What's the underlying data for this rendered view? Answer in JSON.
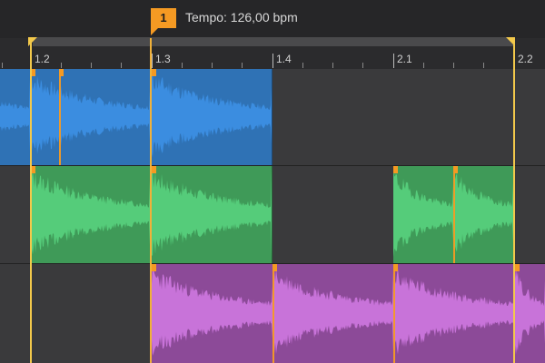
{
  "marker": {
    "number": "1",
    "label": "Tempo: 126,00 bpm"
  },
  "ruler": {
    "bars": [
      "1.2",
      "1.3",
      "1.4",
      "2.1",
      "2.2"
    ]
  },
  "tracks": [
    {
      "color_region": "#2f72b5",
      "color_wave": "#3b8de0"
    },
    {
      "color_region": "#3f9a58",
      "color_wave": "#55cc7a"
    },
    {
      "color_region": "#8c4a98",
      "color_wave": "#c873d9"
    }
  ],
  "colors": {
    "playhead": "#f0b13a",
    "locator": "#f3c94b",
    "marker": "#f59a23"
  }
}
